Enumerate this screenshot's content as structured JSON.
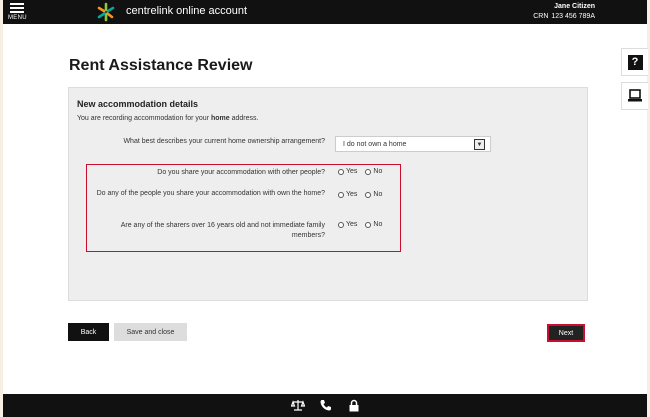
{
  "header": {
    "menu_label": "MENU",
    "app_title": "centrelink online account",
    "user_name": "Jane Citizen",
    "crn_label": "CRN",
    "crn_value": "123 456 789A"
  },
  "side_tools": {
    "help": "?"
  },
  "page": {
    "title": "Rent Assistance Review"
  },
  "section": {
    "title": "New accommodation details",
    "subtitle_pre": "You are recording accommodation for your ",
    "subtitle_bold": "home",
    "subtitle_post": " address.",
    "ownership": {
      "label": "What best describes your current home ownership arrangement?",
      "selected": "I do not own a home"
    },
    "questions": [
      {
        "label": "Do you share your accommodation with other people?",
        "yes": "Yes",
        "no": "No"
      },
      {
        "label": "Do any of the people you share your accommodation with own the home?",
        "yes": "Yes",
        "no": "No"
      },
      {
        "label": "Are any of the sharers over 16 years old and not immediate family members?",
        "yes": "Yes",
        "no": "No"
      }
    ]
  },
  "buttons": {
    "back": "Back",
    "save_close": "Save and close",
    "next": "Next"
  },
  "colors": {
    "highlight": "#c8102e",
    "bar": "#111111",
    "panel": "#eeeeee"
  },
  "footer": {
    "icons": [
      "scales-icon",
      "phone-icon",
      "lock-icon"
    ]
  }
}
